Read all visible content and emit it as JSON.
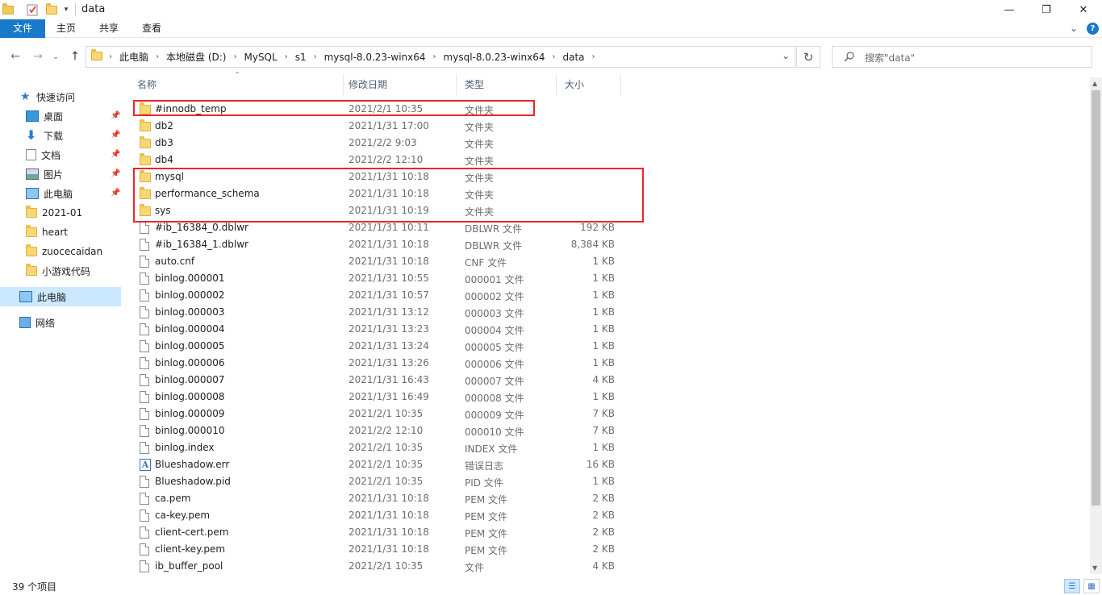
{
  "window": {
    "title": "data",
    "minimize": "—",
    "maximize": "❐",
    "close": "✕"
  },
  "ribbon": {
    "tabs": [
      "文件",
      "主页",
      "共享",
      "查看"
    ],
    "expand": "⌄",
    "help": "?"
  },
  "nav": {
    "back": "←",
    "forward": "→",
    "recent": "⌄",
    "up": "↑"
  },
  "address": {
    "crumbs": [
      "此电脑",
      "本地磁盘 (D:)",
      "MySQL",
      "s1",
      "mysql-8.0.23-winx64",
      "mysql-8.0.23-winx64",
      "data"
    ],
    "dropdown": "⌄",
    "refresh": "↻"
  },
  "search": {
    "placeholder": "搜索\"data\""
  },
  "sidebar": {
    "quick_access": "快速访问",
    "items": [
      "桌面",
      "下载",
      "文档",
      "图片",
      "此电脑",
      "2021-01",
      "heart",
      "zuocecaidan",
      "小游戏代码"
    ],
    "this_pc": "此电脑",
    "network": "网络"
  },
  "columns": {
    "name": "名称",
    "date": "修改日期",
    "type": "类型",
    "size": "大小"
  },
  "files": [
    {
      "name": "#innodb_temp",
      "date": "2021/2/1 10:35",
      "type": "文件夹",
      "size": "",
      "icon": "folder-icon"
    },
    {
      "name": "db2",
      "date": "2021/1/31 17:00",
      "type": "文件夹",
      "size": "",
      "icon": "folder-icon"
    },
    {
      "name": "db3",
      "date": "2021/2/2 9:03",
      "type": "文件夹",
      "size": "",
      "icon": "folder-icon"
    },
    {
      "name": "db4",
      "date": "2021/2/2 12:10",
      "type": "文件夹",
      "size": "",
      "icon": "folder-icon"
    },
    {
      "name": "mysql",
      "date": "2021/1/31 10:18",
      "type": "文件夹",
      "size": "",
      "icon": "folder-icon"
    },
    {
      "name": "performance_schema",
      "date": "2021/1/31 10:18",
      "type": "文件夹",
      "size": "",
      "icon": "folder-icon"
    },
    {
      "name": "sys",
      "date": "2021/1/31 10:19",
      "type": "文件夹",
      "size": "",
      "icon": "folder-icon"
    },
    {
      "name": "#ib_16384_0.dblwr",
      "date": "2021/1/31 10:11",
      "type": "DBLWR 文件",
      "size": "192 KB",
      "icon": "file-icon"
    },
    {
      "name": "#ib_16384_1.dblwr",
      "date": "2021/1/31 10:18",
      "type": "DBLWR 文件",
      "size": "8,384 KB",
      "icon": "file-icon"
    },
    {
      "name": "auto.cnf",
      "date": "2021/1/31 10:18",
      "type": "CNF 文件",
      "size": "1 KB",
      "icon": "file-icon"
    },
    {
      "name": "binlog.000001",
      "date": "2021/1/31 10:55",
      "type": "000001 文件",
      "size": "1 KB",
      "icon": "file-icon"
    },
    {
      "name": "binlog.000002",
      "date": "2021/1/31 10:57",
      "type": "000002 文件",
      "size": "1 KB",
      "icon": "file-icon"
    },
    {
      "name": "binlog.000003",
      "date": "2021/1/31 13:12",
      "type": "000003 文件",
      "size": "1 KB",
      "icon": "file-icon"
    },
    {
      "name": "binlog.000004",
      "date": "2021/1/31 13:23",
      "type": "000004 文件",
      "size": "1 KB",
      "icon": "file-icon"
    },
    {
      "name": "binlog.000005",
      "date": "2021/1/31 13:24",
      "type": "000005 文件",
      "size": "1 KB",
      "icon": "file-icon"
    },
    {
      "name": "binlog.000006",
      "date": "2021/1/31 13:26",
      "type": "000006 文件",
      "size": "1 KB",
      "icon": "file-icon"
    },
    {
      "name": "binlog.000007",
      "date": "2021/1/31 16:43",
      "type": "000007 文件",
      "size": "4 KB",
      "icon": "file-icon"
    },
    {
      "name": "binlog.000008",
      "date": "2021/1/31 16:49",
      "type": "000008 文件",
      "size": "1 KB",
      "icon": "file-icon"
    },
    {
      "name": "binlog.000009",
      "date": "2021/2/1 10:35",
      "type": "000009 文件",
      "size": "7 KB",
      "icon": "file-icon"
    },
    {
      "name": "binlog.000010",
      "date": "2021/2/2 12:10",
      "type": "000010 文件",
      "size": "7 KB",
      "icon": "file-icon"
    },
    {
      "name": "binlog.index",
      "date": "2021/2/1 10:35",
      "type": "INDEX 文件",
      "size": "1 KB",
      "icon": "file-icon"
    },
    {
      "name": "Blueshadow.err",
      "date": "2021/2/1 10:35",
      "type": "错误日志",
      "size": "16 KB",
      "icon": "error-log-icon"
    },
    {
      "name": "Blueshadow.pid",
      "date": "2021/2/1 10:35",
      "type": "PID 文件",
      "size": "1 KB",
      "icon": "file-icon"
    },
    {
      "name": "ca.pem",
      "date": "2021/1/31 10:18",
      "type": "PEM 文件",
      "size": "2 KB",
      "icon": "file-icon"
    },
    {
      "name": "ca-key.pem",
      "date": "2021/1/31 10:18",
      "type": "PEM 文件",
      "size": "2 KB",
      "icon": "file-icon"
    },
    {
      "name": "client-cert.pem",
      "date": "2021/1/31 10:18",
      "type": "PEM 文件",
      "size": "2 KB",
      "icon": "file-icon"
    },
    {
      "name": "client-key.pem",
      "date": "2021/1/31 10:18",
      "type": "PEM 文件",
      "size": "2 KB",
      "icon": "file-icon"
    },
    {
      "name": "ib_buffer_pool",
      "date": "2021/2/1 10:35",
      "type": "文件",
      "size": "4 KB",
      "icon": "file-icon"
    }
  ],
  "status": {
    "item_count": "39 个项目"
  },
  "colors": {
    "accent": "#1979ca",
    "selection": "#cce8ff",
    "highlight_box": "#e8262c",
    "folder": "#f8d775"
  }
}
